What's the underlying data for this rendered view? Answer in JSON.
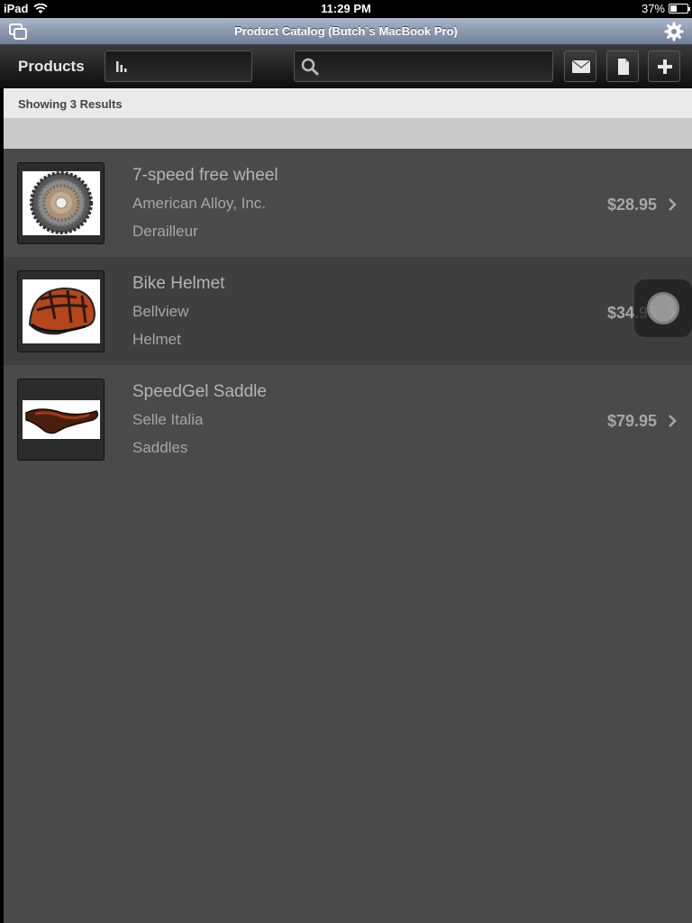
{
  "status_bar": {
    "device": "iPad",
    "time": "11:29 PM",
    "battery": "37%",
    "battery_level": 0.37
  },
  "title_bar": {
    "title": "Product Catalog (Butch`s MacBook Pro)"
  },
  "toolbar": {
    "title": "Products",
    "sort_icon": "bar-chart-icon",
    "search_placeholder": "",
    "search_value": ""
  },
  "results": {
    "summary": "Showing 3 Results"
  },
  "products": [
    {
      "name": "7-speed free wheel",
      "vendor": "American Alloy, Inc.",
      "category": "Derailleur",
      "price": "$28.95",
      "image": "freewheel-cassette"
    },
    {
      "name": "Bike Helmet",
      "vendor": "Bellview",
      "category": "Helmet",
      "price": "$34.95",
      "image": "bike-helmet"
    },
    {
      "name": "SpeedGel Saddle",
      "vendor": "Selle Italia",
      "category": "Saddles",
      "price": "$79.95",
      "image": "bike-saddle"
    }
  ],
  "colors": {
    "title_bar": "#8a98ad",
    "list_bg": "#4a4a4a",
    "text": "#b3b3b3"
  }
}
